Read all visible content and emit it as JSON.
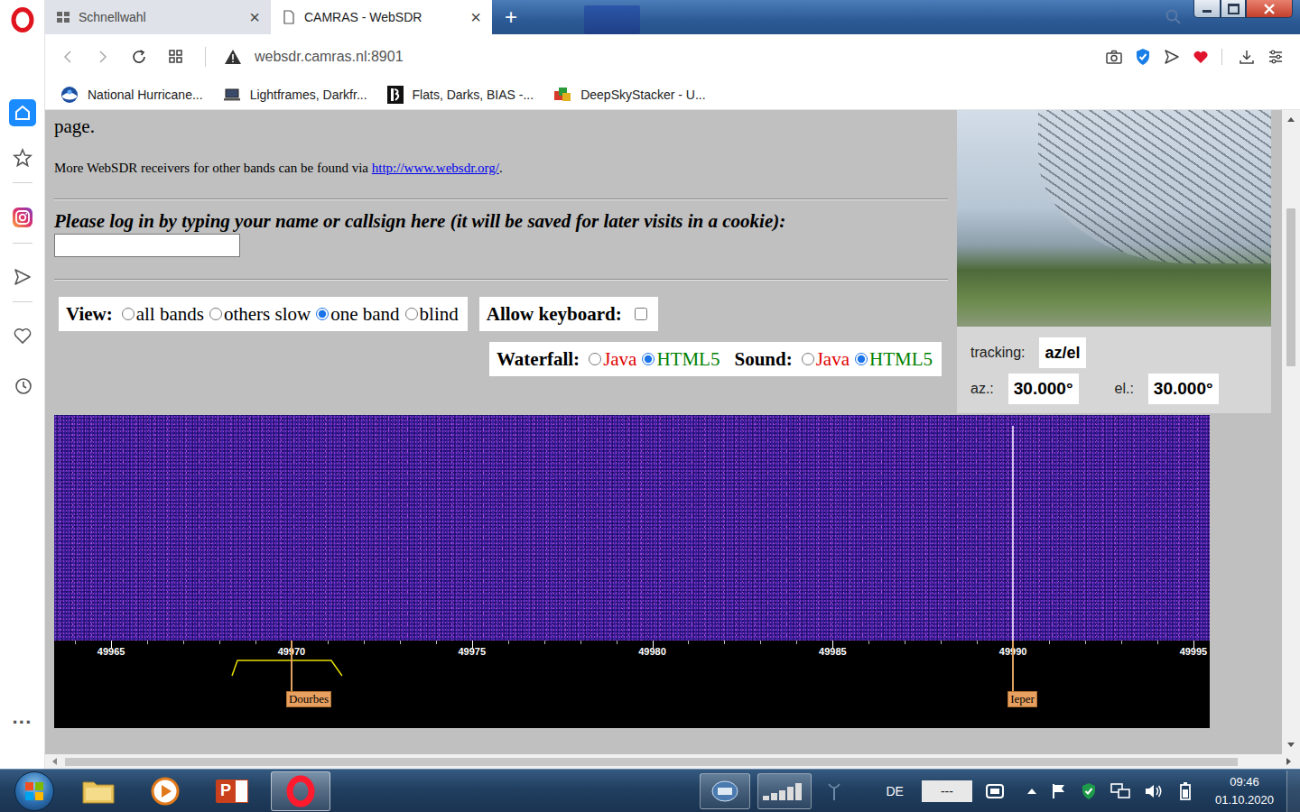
{
  "browser": {
    "tabs": [
      {
        "label": "Schnellwahl",
        "selected": false,
        "close": "×"
      },
      {
        "label": "CAMRAS - WebSDR",
        "selected": true,
        "close": "×"
      }
    ],
    "new_tab": "+",
    "address": "websdr.camras.nl:8901",
    "bookmarks": [
      "National Hurricane...",
      "Lightframes, Darkfr...",
      "Flats, Darks, BIAS -...",
      "DeepSkyStacker - U..."
    ],
    "sidebar_more": "···"
  },
  "page": {
    "intro_tail": "page.",
    "more_text": "More WebSDR receivers for other bands can be found via ",
    "more_link": "http://www.websdr.org/",
    "more_end": ".",
    "login_prompt": "Please log in by typing your name or callsign here (it will be saved for later visits in a cookie):",
    "login_value": "",
    "view": {
      "label": "View:",
      "options": [
        {
          "label": "all bands",
          "selected": false
        },
        {
          "label": "others slow",
          "selected": false
        },
        {
          "label": "one band",
          "selected": true
        },
        {
          "label": "blind",
          "selected": false
        }
      ]
    },
    "keyboard": {
      "label": "Allow keyboard:",
      "checked": false
    },
    "waterfall": {
      "label": "Waterfall:",
      "options": [
        {
          "label": "Java",
          "selected": false,
          "color": "#e00000"
        },
        {
          "label": "HTML5",
          "selected": true,
          "color": "#008000"
        }
      ]
    },
    "sound": {
      "label": "Sound:",
      "options": [
        {
          "label": "Java",
          "selected": false,
          "color": "#e00000"
        },
        {
          "label": "HTML5",
          "selected": true,
          "color": "#008000"
        }
      ]
    }
  },
  "tracking": {
    "label": "tracking:",
    "mode": "az/el",
    "az_label": "az.:",
    "az": "30.000°",
    "el_label": "el.:",
    "el": "30.000°"
  },
  "waterfall": {
    "ticks": [
      "49965",
      "49970",
      "49975",
      "49980",
      "49985",
      "49990",
      "49995"
    ],
    "stations": [
      {
        "name": "Dourbes",
        "frequency": 49970,
        "signal": false
      },
      {
        "name": "Ieper",
        "frequency": 49990,
        "signal": true
      }
    ],
    "passband": {
      "low": 49968.35,
      "high": 49971.4
    }
  },
  "taskbar": {
    "powerpoint_glyph": "P",
    "language": "DE",
    "field": "---",
    "time": "09:46",
    "date": "01.10.2020"
  }
}
